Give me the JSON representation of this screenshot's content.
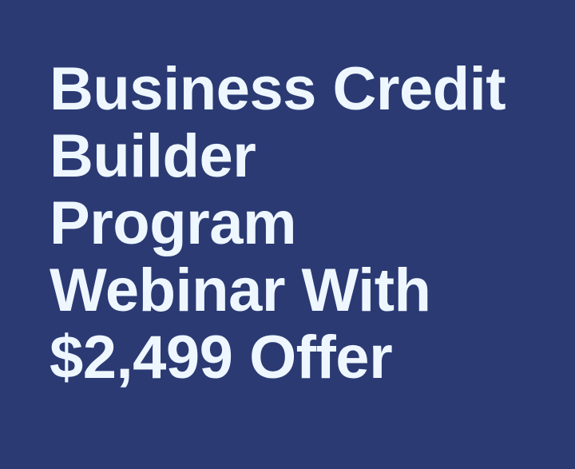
{
  "headline": {
    "lines": [
      "Business Credit",
      "Builder",
      "Program",
      "Webinar With",
      "$2,499 Offer"
    ]
  },
  "colors": {
    "background": "#2b3a73",
    "text": "#eef7ff"
  }
}
